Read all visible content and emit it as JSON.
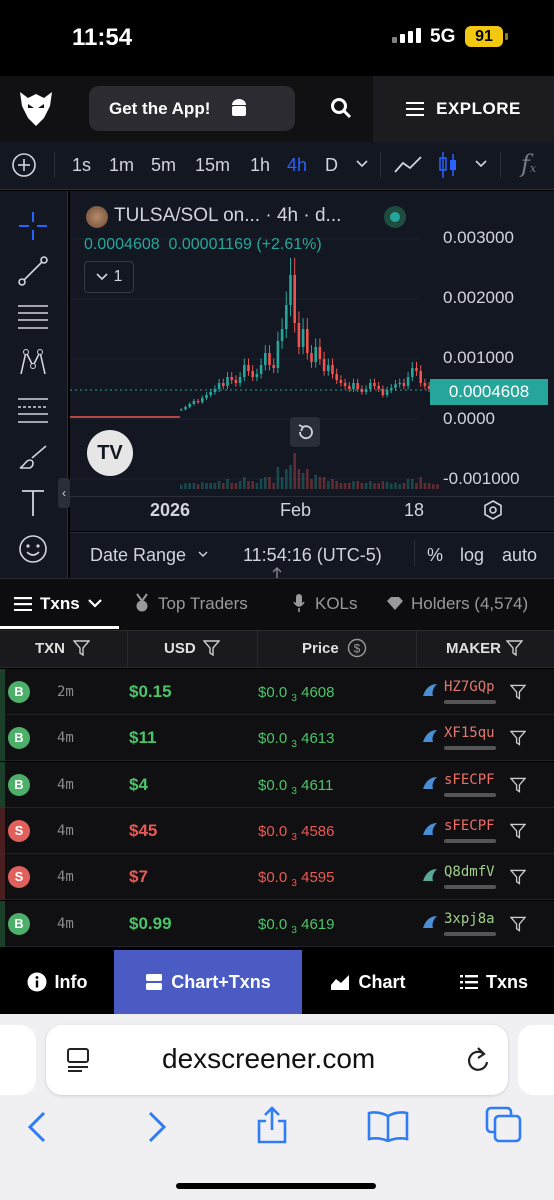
{
  "status": {
    "time": "11:54",
    "network": "5G",
    "battery": "91"
  },
  "header": {
    "get_app": "Get the App!",
    "explore": "EXPLORE"
  },
  "toolbar": {
    "timeframes": [
      "1s",
      "1m",
      "5m",
      "15m",
      "1h",
      "4h",
      "D"
    ],
    "active_timeframe": "4h"
  },
  "chart": {
    "pair_title": "TULSA/SOL on... · 4h · d...",
    "last_price": "0.0004608",
    "change": "0.00001169 (+2.61%)",
    "legend_count": "1",
    "y_ticks": [
      "0.003000",
      "0.002000",
      "0.001000",
      "0.0000",
      "-0.001000"
    ],
    "price_tag": "0.0004608",
    "x_ticks": [
      "2026",
      "Feb",
      "18"
    ],
    "date_range": "Date Range",
    "clock": "11:54:16 (UTC-5)",
    "percent": "%",
    "log": "log",
    "auto": "auto",
    "up_color": "#26a69a",
    "down_color": "#ef5350"
  },
  "tabs": {
    "txns": "Txns",
    "top_traders": "Top Traders",
    "kols": "KOLs",
    "holders": "Holders (4,574)"
  },
  "table": {
    "headers": {
      "txn": "TXN",
      "usd": "USD",
      "price": "Price",
      "maker": "MAKER"
    },
    "rows": [
      {
        "type": "B",
        "age": "2m",
        "usd": "$0.15",
        "price_prefix": "$0.0",
        "price_sub": "3",
        "price_digits": "4608",
        "maker": "HZ7GQp"
      },
      {
        "type": "B",
        "age": "4m",
        "usd": "$11",
        "price_prefix": "$0.0",
        "price_sub": "3",
        "price_digits": "4613",
        "maker": "XF15qu"
      },
      {
        "type": "B",
        "age": "4m",
        "usd": "$4",
        "price_prefix": "$0.0",
        "price_sub": "3",
        "price_digits": "4611",
        "maker": "sFECPF"
      },
      {
        "type": "S",
        "age": "4m",
        "usd": "$45",
        "price_prefix": "$0.0",
        "price_sub": "3",
        "price_digits": "4586",
        "maker": "sFECPF"
      },
      {
        "type": "S",
        "age": "4m",
        "usd": "$7",
        "price_prefix": "$0.0",
        "price_sub": "3",
        "price_digits": "4595",
        "maker": "Q8dmfV"
      },
      {
        "type": "B",
        "age": "4m",
        "usd": "$0.99",
        "price_prefix": "$0.0",
        "price_sub": "3",
        "price_digits": "4619",
        "maker": "3xpj8a"
      }
    ]
  },
  "bottom_nav": {
    "info": "Info",
    "chart_txns": "Chart+Txns",
    "chart": "Chart",
    "txns": "Txns"
  },
  "browser": {
    "url": "dexscreener.com"
  }
}
